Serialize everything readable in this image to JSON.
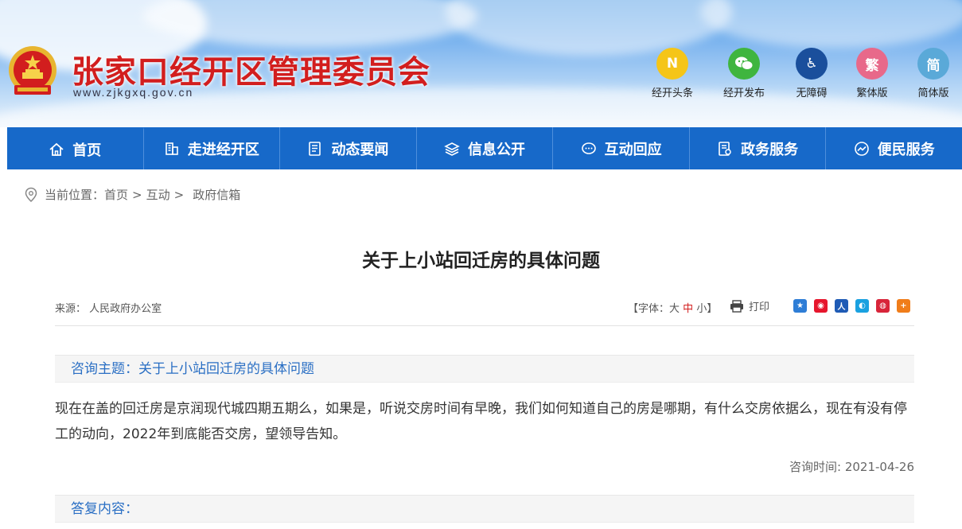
{
  "site": {
    "title": "张家口经开区管理委员会",
    "url": "www.zjkgxq.gov.cn"
  },
  "quick_links": [
    {
      "label": "经开头条",
      "glyph": "N",
      "color": "#f5c518",
      "icon": "news-icon"
    },
    {
      "label": "经开发布",
      "glyph": "✉",
      "color": "#3fb53f",
      "icon": "wechat-icon"
    },
    {
      "label": "无障碍",
      "glyph": "♿",
      "color": "#1a4f9c",
      "icon": "accessibility-icon"
    },
    {
      "label": "繁体版",
      "glyph": "繁",
      "color": "#e8698a",
      "icon": "traditional-icon"
    },
    {
      "label": "简体版",
      "glyph": "简",
      "color": "#5aa9d8",
      "icon": "simplified-icon"
    }
  ],
  "nav": [
    {
      "label": "首页",
      "icon": "home-icon"
    },
    {
      "label": "走进经开区",
      "icon": "building-icon"
    },
    {
      "label": "动态要闻",
      "icon": "news-doc-icon"
    },
    {
      "label": "信息公开",
      "icon": "layers-icon"
    },
    {
      "label": "互动回应",
      "icon": "chat-icon"
    },
    {
      "label": "政务服务",
      "icon": "service-doc-icon"
    },
    {
      "label": "便民服务",
      "icon": "trend-icon"
    }
  ],
  "breadcrumb": {
    "prefix": "当前位置：",
    "items": [
      "首页",
      "互动",
      "政府信箱"
    ],
    "separator": ">"
  },
  "article": {
    "title": "关于上小站回迁房的具体问题",
    "source": "来源： 人民政府办公室",
    "font_label_open": "【字体：",
    "font_large": "大",
    "font_medium": "中",
    "font_small": "小",
    "font_label_close": "】",
    "print_label": "打印",
    "share_icons": [
      {
        "name": "qzone-share-icon",
        "color": "#2e7dd6",
        "glyph": "★"
      },
      {
        "name": "weibo-share-icon",
        "color": "#e6162d",
        "glyph": "◉"
      },
      {
        "name": "people-share-icon",
        "color": "#1f5bb5",
        "glyph": "人"
      },
      {
        "name": "tencent-share-icon",
        "color": "#1aa1e0",
        "glyph": "◐"
      },
      {
        "name": "renren-share-icon",
        "color": "#d8253a",
        "glyph": "◍"
      },
      {
        "name": "more-share-icon",
        "color": "#f07d1a",
        "glyph": "+"
      }
    ],
    "consult_subject": "咨询主题：关于上小站回迁房的具体问题",
    "consult_body": "现在在盖的回迁房是京润现代城四期五期么，如果是，听说交房时间有早晚，我们如何知道自己的房是哪期，有什么交房依据么，现在有没有停工的动向，2022年到底能否交房，望领导告知。",
    "consult_time": "咨询时间: 2021-04-26",
    "reply_head": "答复内容："
  }
}
